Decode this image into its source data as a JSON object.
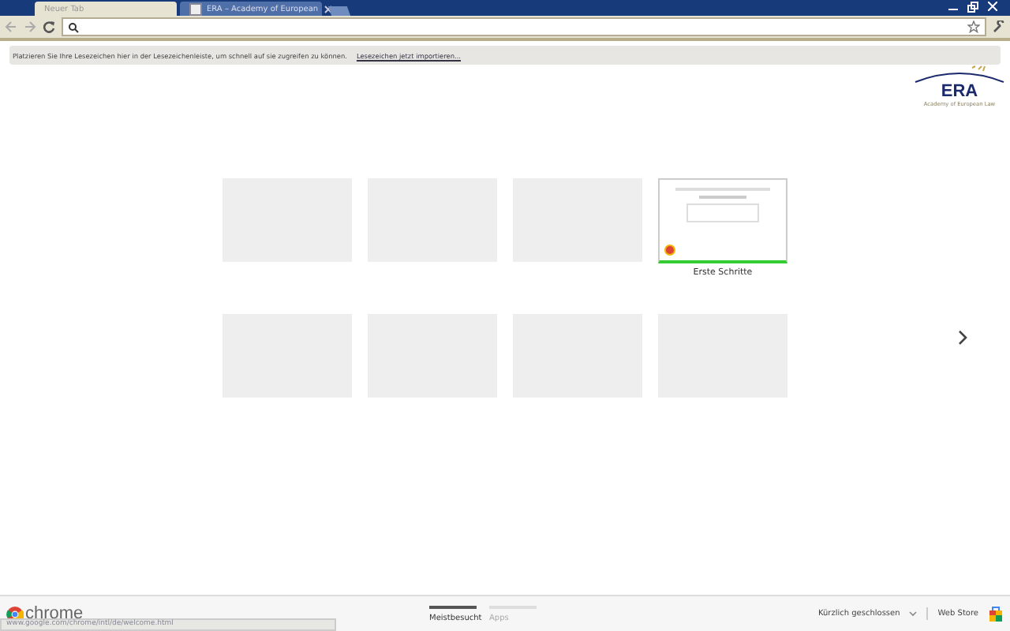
{
  "tabs": [
    {
      "title": "Neuer Tab",
      "selected": true,
      "kind": "newtab"
    },
    {
      "title": "ERA – Academy of European",
      "selected": false,
      "kind": "site"
    }
  ],
  "infobar": {
    "message": "Platzieren Sie Ihre Lesezeichen hier in der Lesezeichenleiste, um schnell auf sie zugreifen zu können.",
    "link": "Lesezeichen jetzt importieren..."
  },
  "logo": {
    "name": "ERA",
    "subtitle": "Academy of European Law"
  },
  "tiles": [
    {
      "kind": "empty"
    },
    {
      "kind": "empty"
    },
    {
      "kind": "empty"
    },
    {
      "kind": "page",
      "title": "Erste Schritte"
    },
    {
      "kind": "empty"
    },
    {
      "kind": "empty"
    },
    {
      "kind": "empty"
    },
    {
      "kind": "empty"
    }
  ],
  "footer": {
    "brand": "chrome",
    "sections": [
      {
        "label": "Meistbesucht",
        "selected": true
      },
      {
        "label": "Apps",
        "selected": false
      }
    ],
    "recently_closed": "Kürzlich geschlossen",
    "store": "Web Store"
  },
  "status_url": "www.google.com/chrome/intl/de/welcome.html"
}
